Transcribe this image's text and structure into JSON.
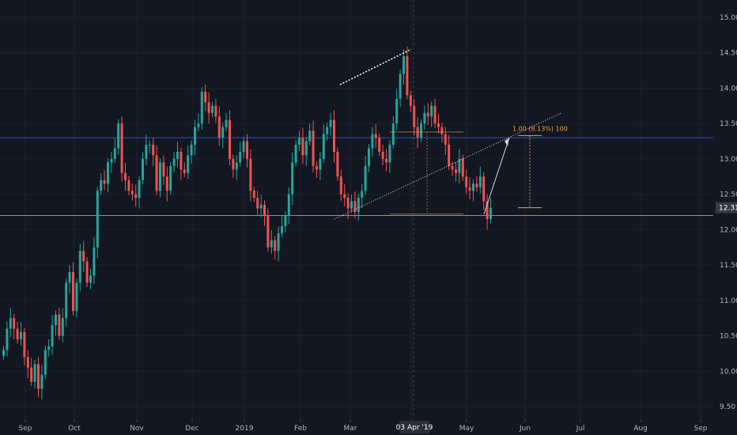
{
  "colors": {
    "background": "#131722",
    "up": "#26a69a",
    "down": "#ef5350",
    "axis_text": "#b2b5be",
    "blue_hline": "#2962ff",
    "orange_hline": "#f0a04b",
    "trendline": "#ffffff",
    "projection": "#f0a04b",
    "price_badge": "#363a45",
    "cursor_badge": "#2a2e39"
  },
  "chart_data": {
    "type": "candlestick",
    "x_axis": {
      "ticks": [
        "Sep",
        "Oct",
        "Nov",
        "Dec",
        "2019",
        "Feb",
        "Mar",
        "Apr",
        "May",
        "Jun",
        "Jul",
        "Aug",
        "Sep"
      ],
      "cursor_label": "03 Apr '19"
    },
    "y_axis": {
      "ticks": [
        "9.50",
        "10.00",
        "10.50",
        "11.00",
        "11.50",
        "12.00",
        "12.50",
        "13.00",
        "13.50",
        "14.00",
        "14.50",
        "15.00"
      ],
      "range": [
        9.4,
        15.2
      ]
    },
    "last_price": "12.31",
    "horizontal_lines": {
      "blue": 13.3,
      "orange": 12.2
    },
    "projection": {
      "label": "1.00 (8.13%) 100",
      "top": 13.33,
      "bottom": 12.31
    },
    "closes": [
      10.3,
      10.6,
      10.75,
      10.6,
      10.45,
      10.55,
      10.2,
      10.05,
      9.85,
      10.1,
      9.75,
      9.95,
      10.3,
      10.35,
      10.65,
      10.8,
      10.5,
      10.75,
      11.25,
      11.4,
      10.85,
      11.25,
      11.7,
      11.55,
      11.25,
      11.35,
      11.75,
      12.55,
      12.7,
      12.65,
      12.95,
      13.0,
      13.15,
      13.5,
      12.8,
      12.7,
      12.55,
      12.5,
      12.45,
      12.7,
      13.0,
      13.2,
      13.2,
      13.05,
      12.55,
      12.95,
      12.75,
      12.55,
      12.9,
      13.0,
      13.1,
      12.85,
      12.8,
      13.05,
      13.2,
      13.45,
      13.5,
      13.95,
      13.8,
      13.65,
      13.75,
      13.6,
      13.3,
      13.45,
      13.55,
      13.0,
      12.85,
      12.95,
      13.1,
      13.25,
      13.0,
      12.55,
      12.45,
      12.3,
      12.35,
      12.2,
      11.75,
      11.85,
      11.7,
      11.95,
      12.05,
      12.2,
      12.5,
      12.95,
      13.2,
      13.3,
      13.05,
      13.25,
      13.4,
      12.9,
      12.85,
      13.0,
      13.35,
      13.45,
      13.55,
      13.1,
      12.75,
      12.5,
      12.45,
      12.3,
      12.4,
      12.25,
      12.45,
      12.55,
      12.9,
      13.15,
      13.35,
      13.3,
      13.1,
      13.0,
      12.95,
      13.2,
      13.5,
      13.85,
      14.2,
      14.45,
      13.9,
      13.75,
      13.45,
      13.3,
      13.5,
      13.65,
      13.6,
      13.75,
      13.5,
      13.45,
      13.35,
      13.2,
      12.9,
      12.85,
      12.8,
      13.0,
      12.75,
      12.6,
      12.55,
      12.65,
      12.6,
      12.75,
      12.4,
      12.15,
      12.31
    ]
  }
}
